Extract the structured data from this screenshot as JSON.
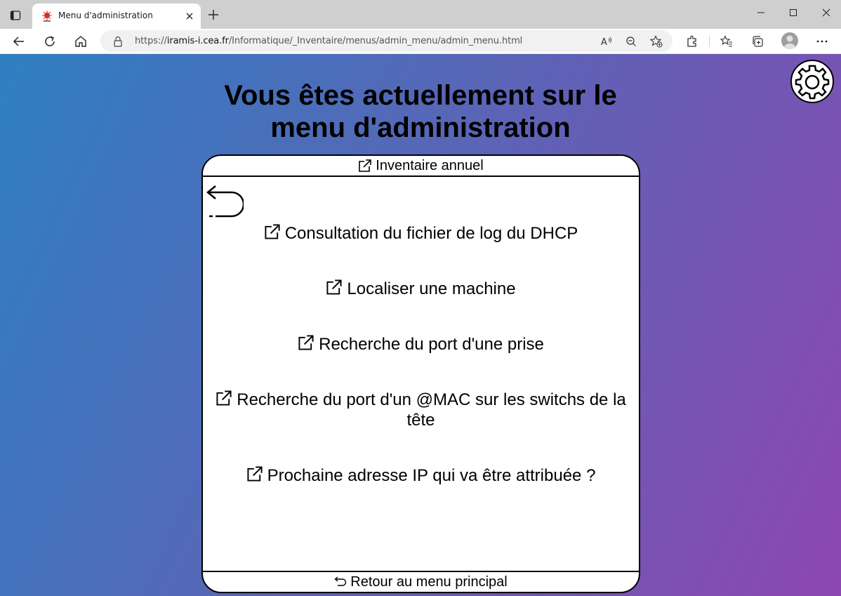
{
  "browser": {
    "tab_title": "Menu d'administration",
    "url_prefix": "https://",
    "url_host": "iramis-i.cea.fr",
    "url_path": "/Informatique/_Inventaire/menus/admin_menu/admin_menu.html"
  },
  "page": {
    "title_line1": "Vous êtes actuellement sur le",
    "title_line2": "menu d'administration",
    "header_link": "Inventaire annuel",
    "links": [
      {
        "label": "Consultation du fichier de log du DHCP"
      },
      {
        "label": "Localiser une machine"
      },
      {
        "label": "Recherche du port d'une prise"
      },
      {
        "label_line1": "Recherche du port d'un @MAC sur les switchs de la",
        "label_line2": "tête"
      },
      {
        "label": "Prochaine adresse IP qui va être attribuée ?"
      }
    ],
    "footer_link": "Retour au menu principal"
  },
  "colors": {
    "gradient_start": "#2f7fc1",
    "gradient_end": "#8d47b2",
    "panel_bg": "#ffffff",
    "text": "#000000"
  }
}
